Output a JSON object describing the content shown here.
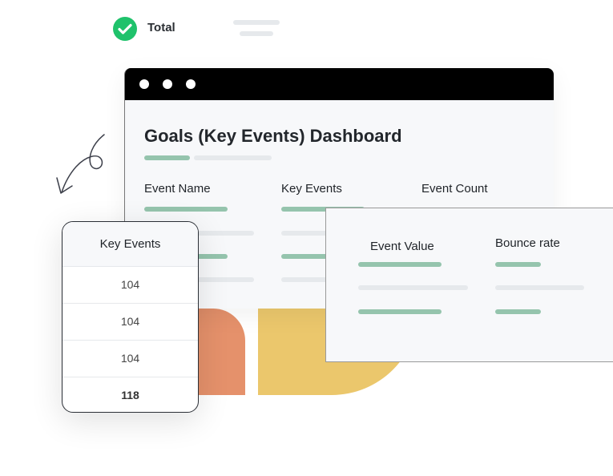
{
  "legend": {
    "label": "Total",
    "icon": "check-circle-icon",
    "color": "#1fc26b"
  },
  "dashboard": {
    "title": "Goals (Key Events) Dashboard",
    "columns": [
      "Event Name",
      "Key Events",
      "Event Count"
    ]
  },
  "detail_panel": {
    "columns": [
      "Event Value",
      "Bounce rate"
    ]
  },
  "key_events_card": {
    "header": "Key Events",
    "rows": [
      "104",
      "104",
      "104",
      "118"
    ]
  },
  "colors": {
    "accent_green": "#95c4ad",
    "orange": "#e5916b",
    "yellow": "#ebc76c",
    "window_bar": "#000000"
  }
}
